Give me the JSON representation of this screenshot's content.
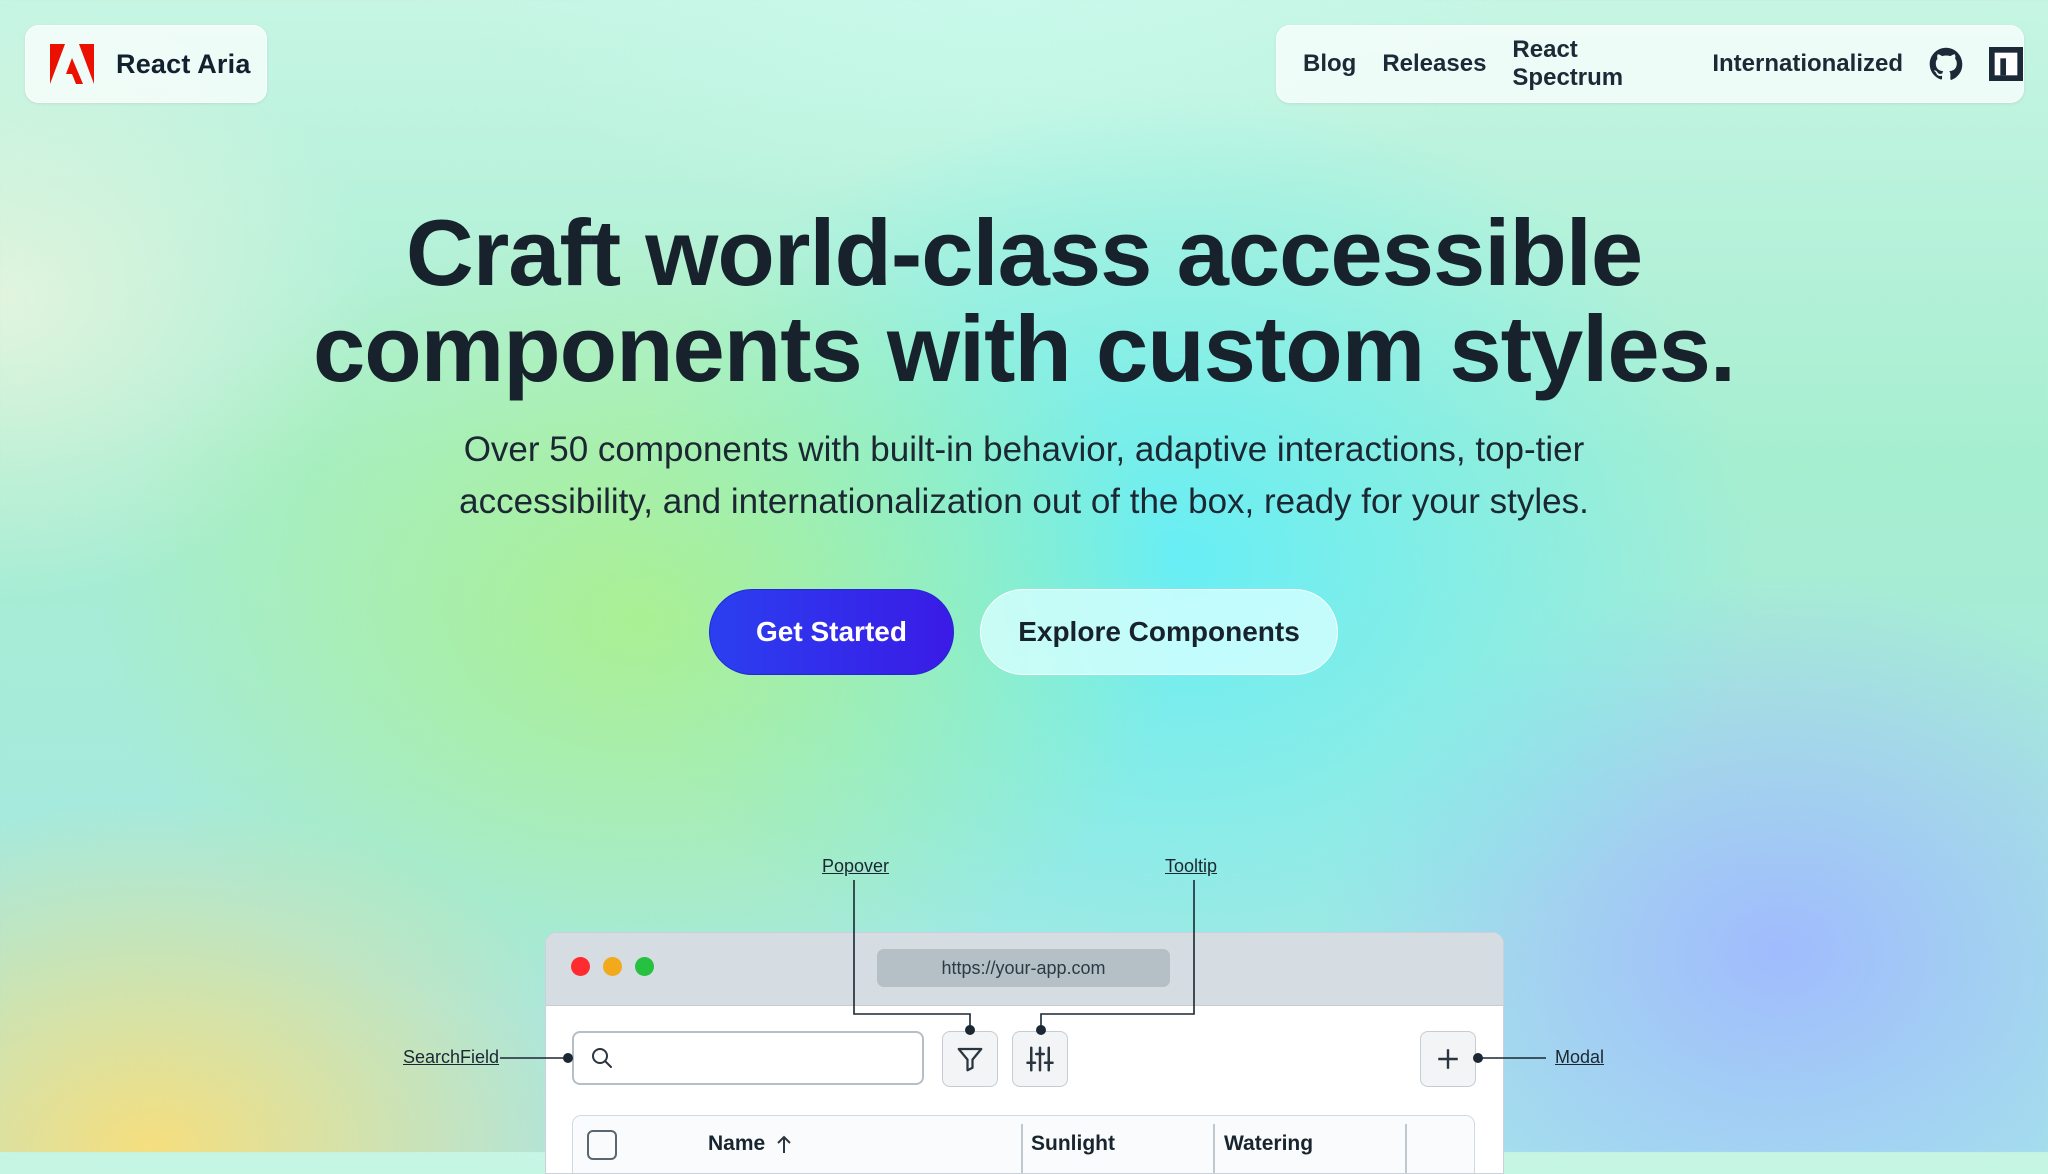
{
  "brand": {
    "name": "React Aria",
    "logo_icon": "adobe-logo-icon",
    "logo_color": "#eb1000"
  },
  "nav": {
    "items": [
      "Blog",
      "Releases",
      "React Spectrum",
      "Internationalized"
    ],
    "icons": [
      "github-icon",
      "npm-icon"
    ]
  },
  "hero": {
    "title_line1": "Craft world-class accessible",
    "title_line2": "components with custom styles.",
    "subtitle_line1": "Over 50 components with built-in behavior, adaptive interactions, top-tier",
    "subtitle_line2": "accessibility, and internationalization out of the box, ready for your styles.",
    "primary_cta": "Get Started",
    "secondary_cta": "Explore Components",
    "primary_color": "#2b3ff0"
  },
  "callouts": {
    "popover": "Popover",
    "tooltip": "Tooltip",
    "searchfield": "SearchField",
    "modal": "Modal"
  },
  "demo": {
    "url": "https://your-app.com",
    "search_placeholder": "",
    "table_columns": [
      "Name",
      "Sunlight",
      "Watering"
    ],
    "sort_icon": "arrow-up-icon",
    "window_controls": {
      "close": "#ff2b30",
      "minimize": "#f2a91b",
      "maximize": "#26c141"
    }
  }
}
